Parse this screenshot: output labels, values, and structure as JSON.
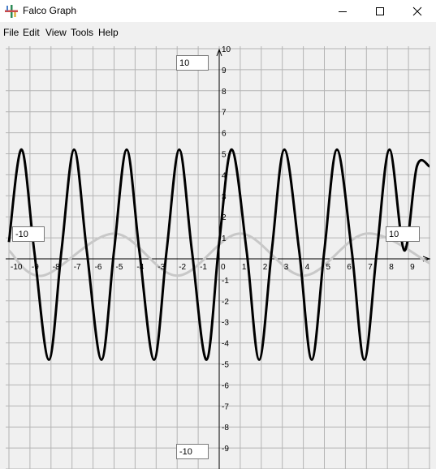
{
  "window": {
    "title": "Falco Graph",
    "icon": "falco-graph-icon",
    "controls": [
      "minimize-icon",
      "maximize-icon",
      "close-icon"
    ]
  },
  "menu": {
    "items": [
      "File",
      "Edit",
      "View",
      "Tools",
      "Help"
    ]
  },
  "graph": {
    "ymax_input": "10",
    "ymin_input": "-10",
    "xmin_input": "-10",
    "xmax_input": "10",
    "grid": true,
    "colors": {
      "background": "#f0f0f0",
      "grid": "#b4b4b4",
      "axis": "#000000",
      "curve1": "#000000",
      "curve2": "#c8c8c8"
    }
  },
  "chart_data": {
    "type": "line",
    "xlim": [
      -10,
      10
    ],
    "ylim": [
      -10,
      10
    ],
    "x_ticks": [
      "-10",
      "-9",
      "-8",
      "-7",
      "-6",
      "-5",
      "-4",
      "-3",
      "-2",
      "-1",
      "0",
      "1",
      "2",
      "3",
      "4",
      "5",
      "6",
      "7",
      "8",
      "9"
    ],
    "y_ticks": [
      "10",
      "9",
      "8",
      "7",
      "6",
      "5",
      "4",
      "3",
      "2",
      "1",
      "-1",
      "-2",
      "-3",
      "-4",
      "-5",
      "-6",
      "-7",
      "-8",
      "-9"
    ],
    "series": [
      {
        "color": "#000000",
        "x": [
          -10,
          -9.4,
          -8.8,
          -8.1,
          -7.5,
          -6.9,
          -6.3,
          -5.6,
          -5,
          -4.4,
          -3.8,
          -3.1,
          -2.5,
          -1.9,
          -1.3,
          -0.6,
          0,
          0.6,
          1.3,
          1.9,
          2.5,
          3.1,
          3.8,
          4.4,
          5,
          5.6,
          6.3,
          6.9,
          7.5,
          8.1,
          8.8,
          9.4,
          10
        ],
        "y": [
          0.8,
          5.2,
          0.4,
          -4.8,
          0.4,
          5.2,
          0.4,
          -4.8,
          0.4,
          5.2,
          0.4,
          -4.8,
          0.4,
          5.2,
          0.4,
          -4.8,
          0.8,
          5.2,
          0.4,
          -4.8,
          0.4,
          5.2,
          0.4,
          -4.8,
          0.4,
          5.2,
          0.4,
          -4.8,
          0.4,
          5.2,
          0.4,
          4.4,
          4.4
        ]
      },
      {
        "color": "#c8c8c8",
        "x": [
          -10,
          -8.4,
          -5,
          -2,
          1,
          4,
          7,
          10
        ],
        "y": [
          0.4,
          -0.8,
          1.2,
          -0.8,
          1.2,
          -0.8,
          1.2,
          -0.2
        ]
      }
    ]
  }
}
